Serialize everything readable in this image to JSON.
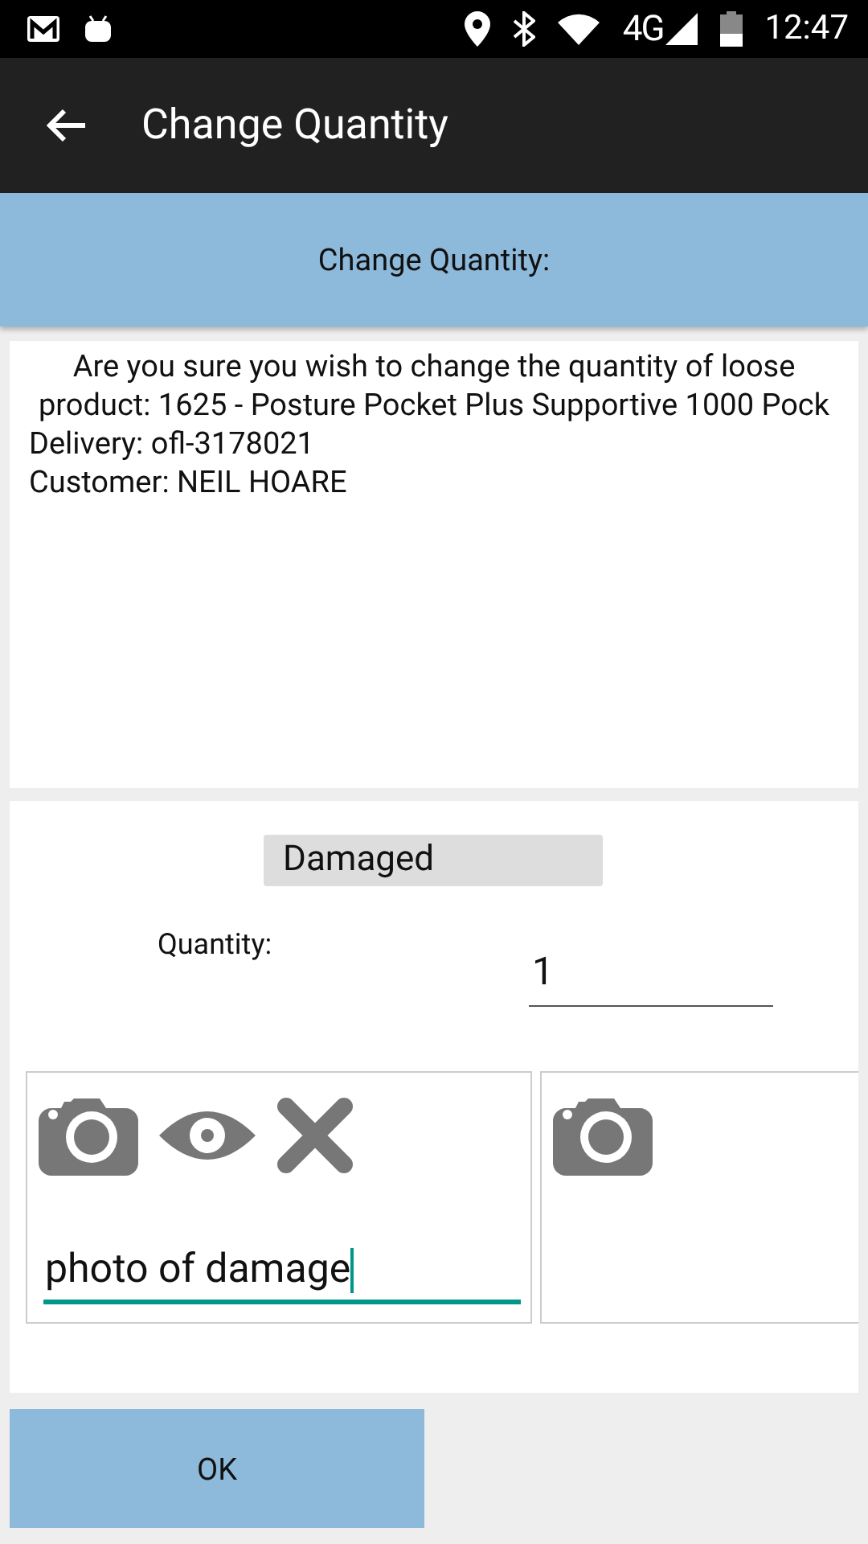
{
  "status_bar": {
    "network": "4G",
    "time": "12:47"
  },
  "app_bar": {
    "title": "Change Quantity"
  },
  "header": {
    "title": "Change Quantity:"
  },
  "message": {
    "text": "Are you sure you wish to change the quantity of loose product: 1625 - Posture Pocket Plus Supportive 1000 Pock",
    "delivery": "Delivery: ofl-3178021",
    "customer": "Customer: NEIL HOARE"
  },
  "reason": {
    "label": "Damaged"
  },
  "quantity": {
    "label": "Quantity:",
    "value": "1"
  },
  "photos": [
    {
      "kind": "taken",
      "caption": "photo of damage",
      "focused": true
    },
    {
      "kind": "empty"
    }
  ],
  "ok_button": {
    "label": "OK"
  }
}
